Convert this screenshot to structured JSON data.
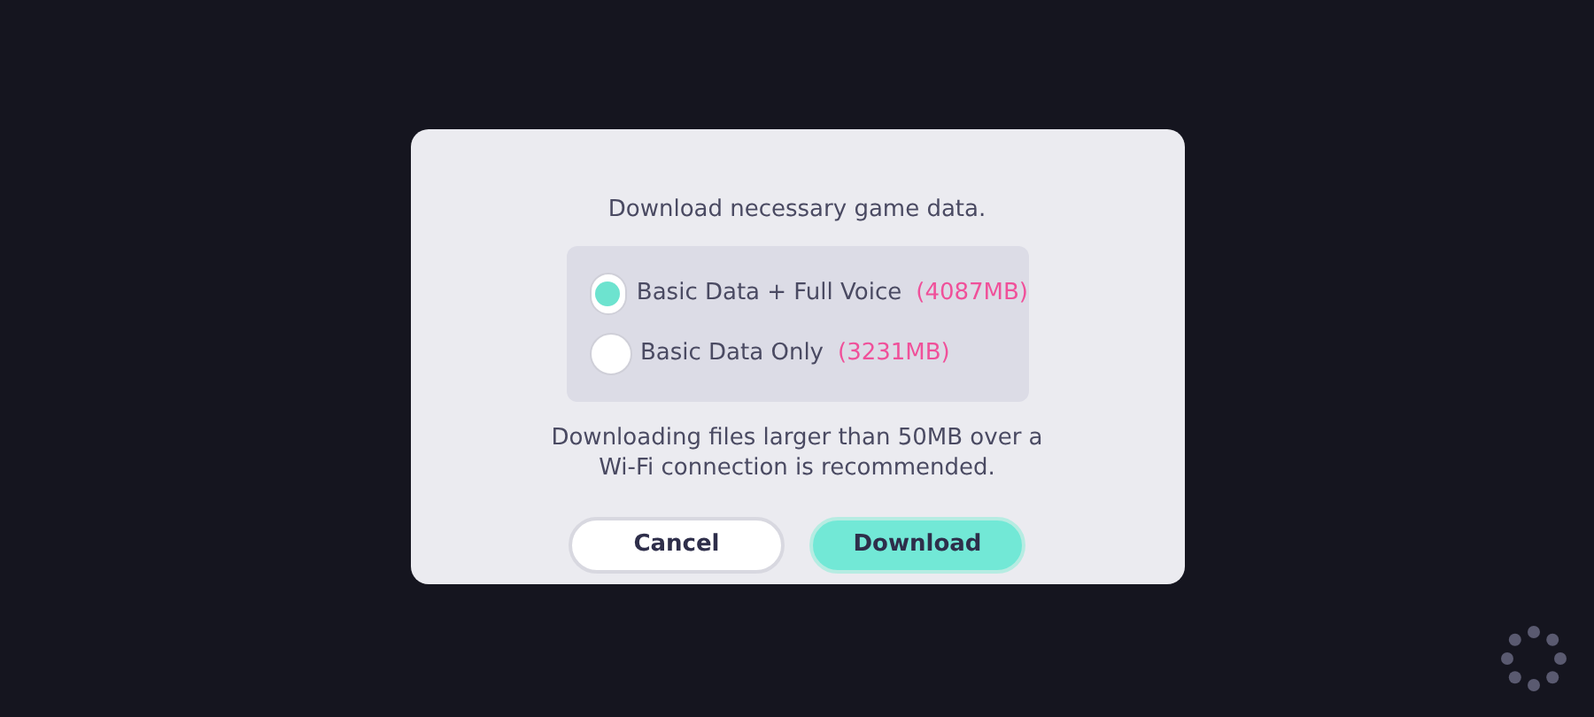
{
  "dialog": {
    "message": "Download necessary game data.",
    "options": [
      {
        "label": "Basic Data + Full Voice",
        "size": "(4087MB)",
        "selected": true
      },
      {
        "label": "Basic Data Only",
        "size": "(3231MB)",
        "selected": false
      }
    ],
    "note": "Downloading files larger than 50MB over a Wi-Fi connection is recommended.",
    "buttons": [
      {
        "label": "Cancel",
        "kind": "secondary"
      },
      {
        "label": "Download",
        "kind": "primary"
      }
    ]
  }
}
